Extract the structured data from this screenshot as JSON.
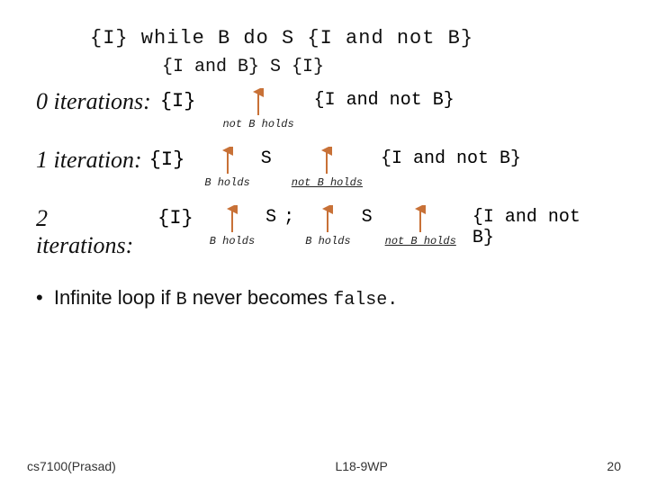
{
  "slide": {
    "top_formula": "{I} while B do S {I and not B}",
    "hoare_triple": "{I and B}    S    {I}",
    "section0": {
      "label": "0 iterations:",
      "mono_label": "{I}",
      "result": "{I and not B}",
      "holds_label": "not B holds"
    },
    "section1": {
      "label": "1 iteration:",
      "mono_label": "{I}",
      "s_label": "S",
      "result": "{I and not B}",
      "b_holds": "B holds",
      "not_b_holds": "not B holds"
    },
    "section2": {
      "label": "2 iterations:",
      "mono_label": "{I}",
      "s1_label": "S",
      "semicolon": ";",
      "s2_label": "S",
      "result": "{I and not B}",
      "b_holds1": "B holds",
      "b_holds2": "B holds",
      "not_b_holds": "not B holds"
    },
    "bullet": {
      "text": "Infinite loop if",
      "mono1": "B",
      "text2": "never becomes",
      "mono2": "false."
    },
    "footer": {
      "left": "cs7100(Prasad)",
      "center": "L18-9WP",
      "right": "20"
    }
  }
}
